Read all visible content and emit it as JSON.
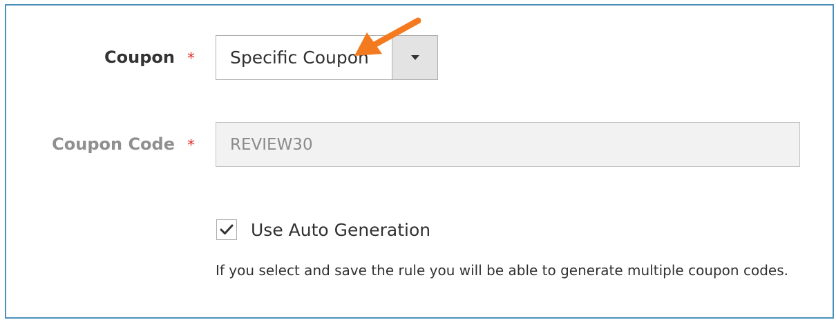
{
  "form": {
    "coupon": {
      "label": "Coupon",
      "required_mark": "*",
      "selected_value": "Specific Coupon"
    },
    "coupon_code": {
      "label": "Coupon Code",
      "required_mark": "*",
      "value": "REVIEW30"
    },
    "auto_generation": {
      "label": "Use Auto Generation",
      "checked": true,
      "note": "If you select and save the rule you will be able to generate multiple coupon codes."
    }
  },
  "colors": {
    "required": "#e02b27",
    "annotation_arrow": "#f47a1f",
    "frame_border": "#4a90b8"
  },
  "icons": {
    "dropdown": "triangle-down",
    "checkbox": "checkmark",
    "annotation": "orange-arrow"
  }
}
